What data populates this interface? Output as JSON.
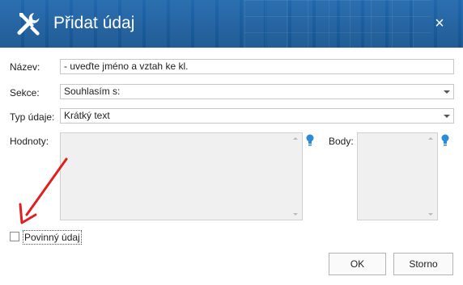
{
  "dialog": {
    "title": "Přidat údaj",
    "close_glyph": "×",
    "icon": "wrench-screwdriver-icon",
    "accent_color": "#1c5ea0"
  },
  "form": {
    "name_label": "Název:",
    "name_value": "- uveďte jméno a vztah ke kl.",
    "section_label": "Sekce:",
    "section_value": "Souhlasím s:",
    "type_label": "Typ údaje:",
    "type_value": "Krátký text",
    "values_label": "Hodnoty:",
    "points_label": "Body:",
    "required_label": "Povinný údaj",
    "required_checked": false
  },
  "buttons": {
    "ok_label": "OK",
    "cancel_label": "Storno"
  },
  "annotation": {
    "arrow_color": "#e02020"
  }
}
